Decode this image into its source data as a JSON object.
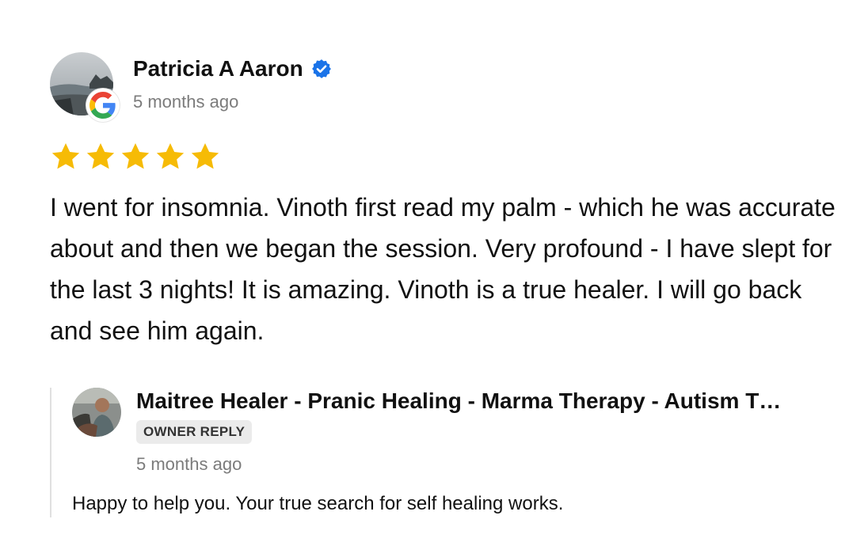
{
  "review": {
    "reviewer_name": "Patricia A Aaron",
    "time_ago": "5 months ago",
    "rating": 5,
    "rating_max": 5,
    "text": "I went for insomnia. Vinoth first read my palm - which he was accurate about and then we began the session. Very profound - I have slept for the last 3 nights! It is amazing. Vinoth is a true healer. I will go back and see him again.",
    "verified_icon": "verified-badge-icon",
    "source_icon": "google-g-icon"
  },
  "reply": {
    "owner_name": "Maitree Healer - Pranic Healing - Marma Therapy - Autism T…",
    "badge_label": "OWNER REPLY",
    "time_ago": "5 months ago",
    "text": "Happy to help you. Your true search for self healing works."
  },
  "colors": {
    "star": "#F6BB06",
    "verified": "#1A73E8",
    "muted_text": "#7B7B7B",
    "badge_bg": "#EBEBEB"
  }
}
